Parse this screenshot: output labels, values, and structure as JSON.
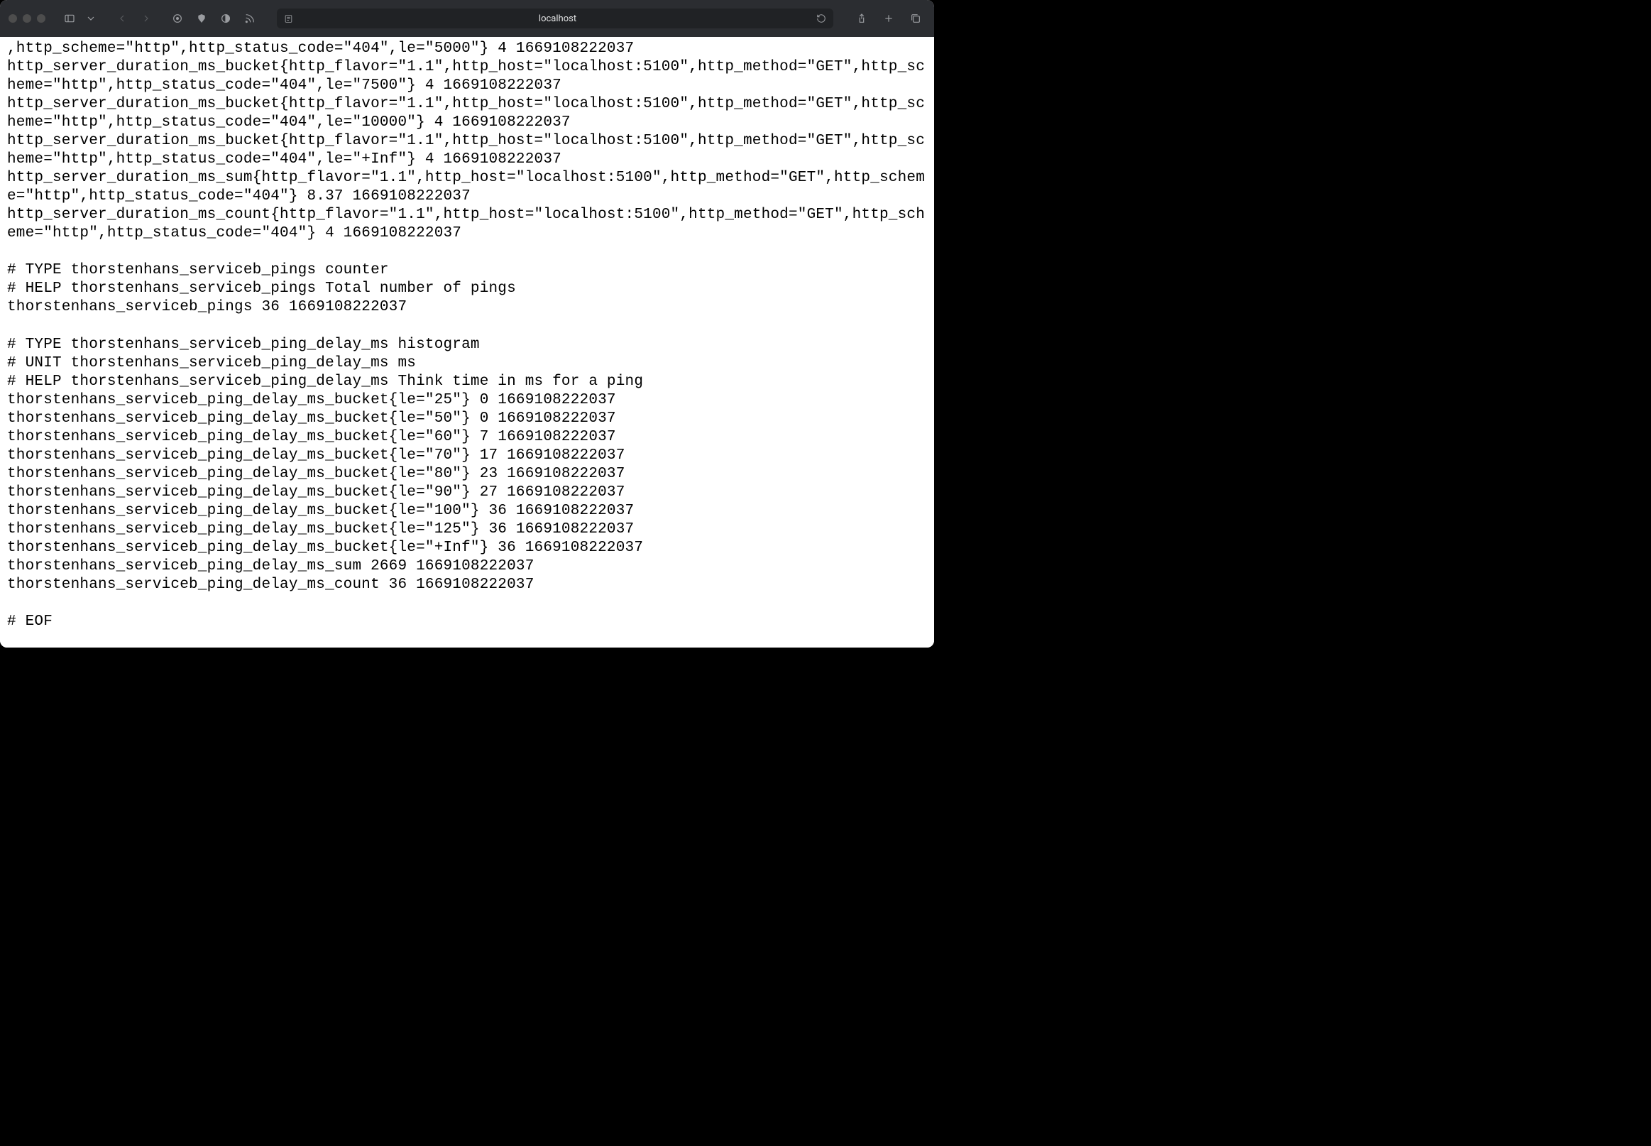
{
  "browser": {
    "address": "localhost"
  },
  "metrics": {
    "lines": [
      ",http_scheme=\"http\",http_status_code=\"404\",le=\"5000\"} 4 1669108222037",
      "http_server_duration_ms_bucket{http_flavor=\"1.1\",http_host=\"localhost:5100\",http_method=\"GET\",http_scheme=\"http\",http_status_code=\"404\",le=\"7500\"} 4 1669108222037",
      "http_server_duration_ms_bucket{http_flavor=\"1.1\",http_host=\"localhost:5100\",http_method=\"GET\",http_scheme=\"http\",http_status_code=\"404\",le=\"10000\"} 4 1669108222037",
      "http_server_duration_ms_bucket{http_flavor=\"1.1\",http_host=\"localhost:5100\",http_method=\"GET\",http_scheme=\"http\",http_status_code=\"404\",le=\"+Inf\"} 4 1669108222037",
      "http_server_duration_ms_sum{http_flavor=\"1.1\",http_host=\"localhost:5100\",http_method=\"GET\",http_scheme=\"http\",http_status_code=\"404\"} 8.37 1669108222037",
      "http_server_duration_ms_count{http_flavor=\"1.1\",http_host=\"localhost:5100\",http_method=\"GET\",http_scheme=\"http\",http_status_code=\"404\"} 4 1669108222037",
      "",
      "# TYPE thorstenhans_serviceb_pings counter",
      "# HELP thorstenhans_serviceb_pings Total number of pings",
      "thorstenhans_serviceb_pings 36 1669108222037",
      "",
      "# TYPE thorstenhans_serviceb_ping_delay_ms histogram",
      "# UNIT thorstenhans_serviceb_ping_delay_ms ms",
      "# HELP thorstenhans_serviceb_ping_delay_ms Think time in ms for a ping",
      "thorstenhans_serviceb_ping_delay_ms_bucket{le=\"25\"} 0 1669108222037",
      "thorstenhans_serviceb_ping_delay_ms_bucket{le=\"50\"} 0 1669108222037",
      "thorstenhans_serviceb_ping_delay_ms_bucket{le=\"60\"} 7 1669108222037",
      "thorstenhans_serviceb_ping_delay_ms_bucket{le=\"70\"} 17 1669108222037",
      "thorstenhans_serviceb_ping_delay_ms_bucket{le=\"80\"} 23 1669108222037",
      "thorstenhans_serviceb_ping_delay_ms_bucket{le=\"90\"} 27 1669108222037",
      "thorstenhans_serviceb_ping_delay_ms_bucket{le=\"100\"} 36 1669108222037",
      "thorstenhans_serviceb_ping_delay_ms_bucket{le=\"125\"} 36 1669108222037",
      "thorstenhans_serviceb_ping_delay_ms_bucket{le=\"+Inf\"} 36 1669108222037",
      "thorstenhans_serviceb_ping_delay_ms_sum 2669 1669108222037",
      "thorstenhans_serviceb_ping_delay_ms_count 36 1669108222037",
      "",
      "# EOF"
    ]
  }
}
